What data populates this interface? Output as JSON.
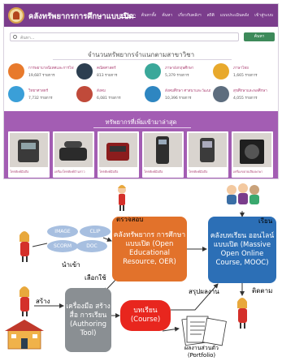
{
  "site": {
    "brand": "คลังทรัพยากรการศึกษาแบบเปิด",
    "nav": [
      "หน้าแรก",
      "ค้นหาทั้ง",
      "ค้นหา",
      "เกี่ยวกับคลังฯ",
      "สถิติ",
      "แบบประเมินคลัง",
      "เข้าสู่ระบบ"
    ],
    "active_nav": "หน้าแรก"
  },
  "search": {
    "placeholder": "ค้นหา...",
    "button": "ค้นหา"
  },
  "stats": {
    "title": "จำนวนทรัพยากรจำแนกตามสาขาวิชา",
    "items": [
      {
        "name": "การพยาบาลนิเทศและการไฟฟ้า",
        "count": "19,687 รายการ",
        "color": "#e87a2c"
      },
      {
        "name": "คณิตศาสตร์",
        "count": "813 รายการ",
        "color": "#2c3e50"
      },
      {
        "name": "ภาษาอังกฤษศึกษา",
        "count": "5,379 รายการ",
        "color": "#3aa89a"
      },
      {
        "name": "ภาษาไทย",
        "count": "1,665 รายการ",
        "color": "#e8a92c"
      },
      {
        "name": "วิทยาศาสตร์",
        "count": "7,732 รายการ",
        "color": "#3a9fd8"
      },
      {
        "name": "สังคม",
        "count": "6,081 รายการ",
        "color": "#c04a3a"
      },
      {
        "name": "สังคมศึกษา ศาสนาและวัฒนธรรม",
        "count": "10,396 รายการ",
        "color": "#2e86c1"
      },
      {
        "name": "สุขศึกษาและพลศึกษา",
        "count": "4,055 รายการ",
        "color": "#5d6d7e"
      }
    ]
  },
  "latest": {
    "title": "ทรัพยากรที่เพิ่มเข้ามาล่าสุด",
    "items": [
      "โทรศัพท์มือถือ",
      "เครื่องโทรศัพท์บ้านราว",
      "โทรศัพท์มือถือ",
      "โทรศัพท์มือถือ",
      "โทรศัพท์มือถือ",
      "เครื่องขยายเสียงพกพา"
    ]
  },
  "diagram": {
    "oer": "คลังทรัพยากร การศึกษาแบบเปิด (Open Educational Resource, OER)",
    "mooc": "คลังบทเรียน ออนไลน์แบบเปิด (Massive Open Online Course, MOOC)",
    "tool": "เครื่องมือ สร้างสื่อ การเรียน (Authoring Tool)",
    "course": "บทเรียน (Course)",
    "portfolio": "ผลงานส่วนตัว (Portfolio)",
    "media_types": [
      "IMAGE",
      "CLIP",
      "SCORM",
      "DOC"
    ],
    "labels": {
      "review": "ตรวจสอบ",
      "import": "นำเข้า",
      "select": "เลือกใช้",
      "create": "สร้าง",
      "summarize": "สรุปผลงาน",
      "learn": "เรียน",
      "follow": "ติดตาม"
    }
  }
}
